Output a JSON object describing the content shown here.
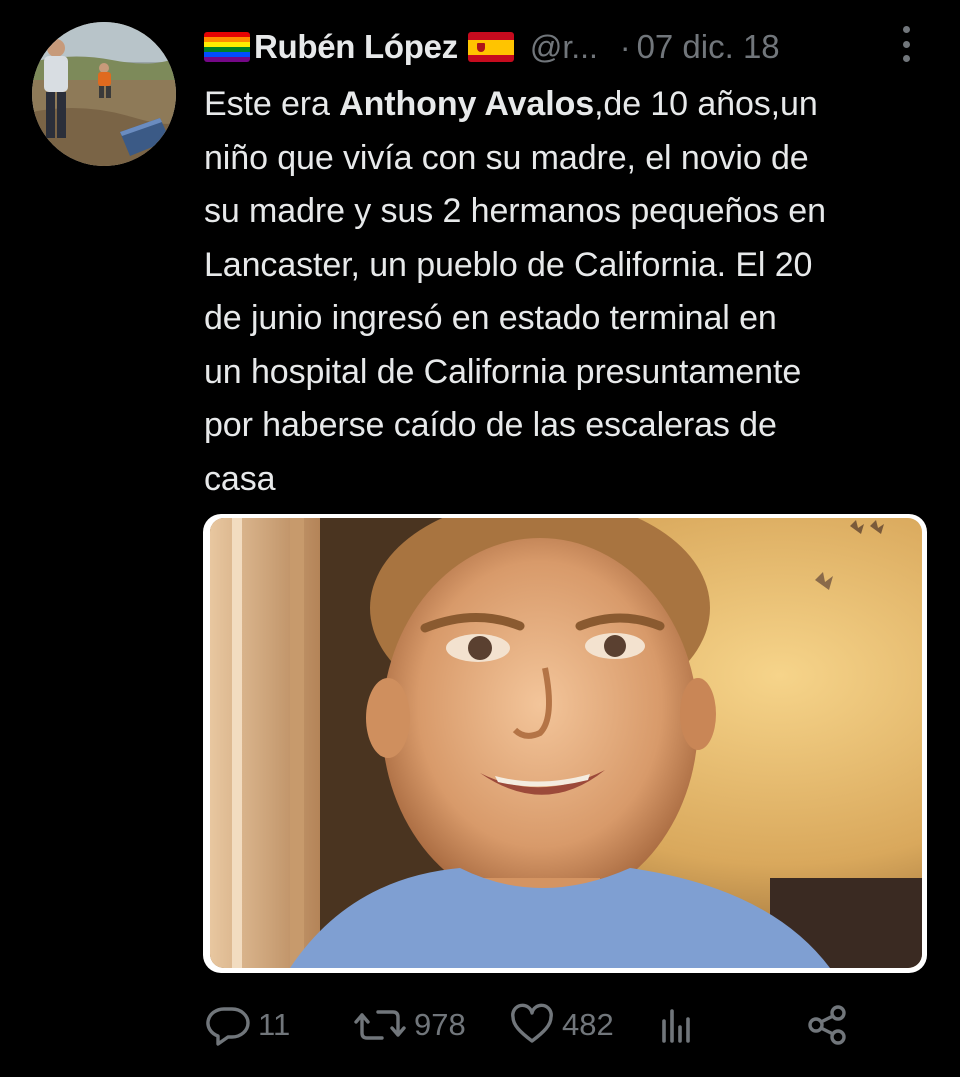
{
  "user": {
    "display_name": "Rubén López",
    "handle": "@r...",
    "separator": "·",
    "timestamp": "07 dic. 18"
  },
  "tweet": {
    "lines": [
      [
        "Este era ",
        "Anthony Avalos",
        ",de 10 años,un"
      ],
      "niño que vivía con su madre, el novio de",
      "su madre y sus 2 hermanos pequeños en",
      "Lancaster, un pueblo de California. El 20",
      "de junio ingresó en estado terminal en",
      "un hospital de California presuntamente",
      "por haberse caído de las escaleras de",
      "casa"
    ],
    "line1_prefix": "Este era ",
    "line1_bold": "Anthony Avalos",
    "line1_suffix": ",de 10 años,un",
    "line2": "niño que vivía con su madre, el novio de",
    "line3": "su madre y sus 2 hermanos pequeños en",
    "line4": "Lancaster, un pueblo de California. El 20",
    "line5": "de junio ingresó en estado terminal en",
    "line6": "un hospital de California presuntamente",
    "line7": "por haberse caído de las escaleras de",
    "line8": "casa"
  },
  "actions": {
    "replies": "11",
    "retweets": "978",
    "likes": "482"
  },
  "icons": {
    "reply": "reply-icon",
    "retweet": "retweet-icon",
    "like": "heart-icon",
    "views": "analytics-icon",
    "share": "share-icon",
    "more": "more-vertical-icon"
  },
  "colors": {
    "background": "#000000",
    "text": "#e7e9ea",
    "secondary": "#71767b"
  }
}
